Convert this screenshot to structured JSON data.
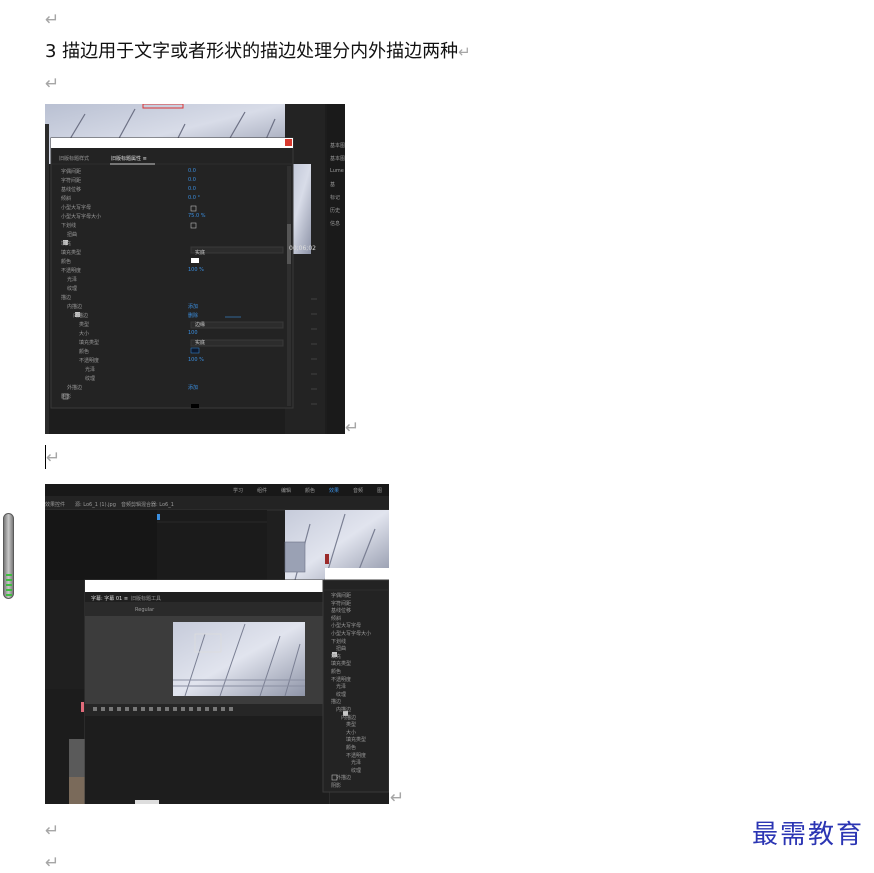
{
  "document": {
    "paragraph_mark": "↵",
    "heading": "3 描边用于文字或者形状的描边处理分内外描边两种",
    "watermark": "最需教育"
  },
  "screenshot1": {
    "tab_left": "旧版标题样式",
    "tab_active": "旧版标题属性 ≡",
    "rows": [
      "字偶间距",
      "字符间距",
      "基线位移",
      "倾斜",
      "小型大写字母",
      "小型大写字母大小",
      "下划线",
      "扭曲",
      "填充",
      "填充类型",
      "颜色",
      "不透明度",
      "光泽",
      "纹理",
      "描边",
      "内描边",
      "内描边",
      "类型",
      "大小",
      "填充类型",
      "颜色",
      "不透明度",
      "光泽",
      "纹理",
      "外描边",
      "阴影"
    ],
    "values": [
      "0.0",
      "0.0",
      "0.0",
      "0.0 °",
      "",
      "75.0 %",
      "",
      "",
      "",
      "实底",
      "",
      "100 %",
      "",
      "",
      "",
      "添加",
      "删除",
      "边缘",
      "100",
      "实底",
      "",
      "100 %",
      "",
      "",
      "添加",
      ""
    ],
    "timecode": "00;06;02",
    "side_labels": [
      "基本图",
      "基本图",
      "Lume",
      "基",
      "标记",
      "历史",
      "信息"
    ]
  },
  "screenshot2": {
    "top_menu": [
      "学习",
      "组件",
      "编辑",
      "颜色",
      "效果",
      "音频",
      "图"
    ],
    "tabs": [
      "效果控件",
      "源: Lo6_1 (1).jpg",
      "音频剪辑混合器: Lo6_1"
    ],
    "title_tab": "字幕: 字幕 01 ≡",
    "title_tab2": "旧版标题工具",
    "font_name": "Regular"
  }
}
